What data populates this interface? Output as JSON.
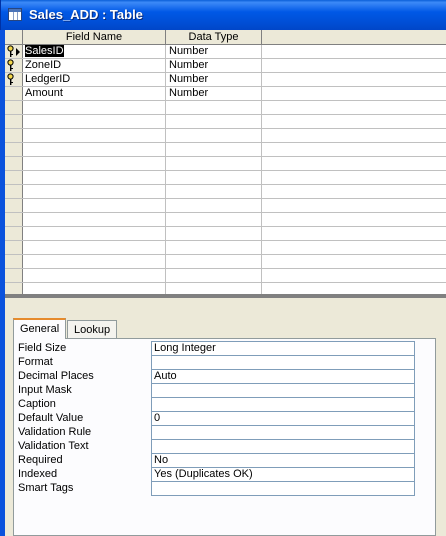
{
  "window": {
    "title": "Sales_ADD : Table"
  },
  "grid": {
    "columns": [
      "Field Name",
      "Data Type"
    ],
    "rows": [
      {
        "name": "SalesID",
        "type": "Number",
        "key": true,
        "current": true
      },
      {
        "name": "ZoneID",
        "type": "Number",
        "key": true,
        "current": false
      },
      {
        "name": "LedgerID",
        "type": "Number",
        "key": true,
        "current": false
      },
      {
        "name": "Amount",
        "type": "Number",
        "key": false,
        "current": false
      }
    ]
  },
  "tabs": {
    "general": "General",
    "lookup": "Lookup"
  },
  "properties": [
    {
      "label": "Field Size",
      "value": "Long Integer"
    },
    {
      "label": "Format",
      "value": ""
    },
    {
      "label": "Decimal Places",
      "value": "Auto"
    },
    {
      "label": "Input Mask",
      "value": ""
    },
    {
      "label": "Caption",
      "value": ""
    },
    {
      "label": "Default Value",
      "value": "0"
    },
    {
      "label": "Validation Rule",
      "value": ""
    },
    {
      "label": "Validation Text",
      "value": ""
    },
    {
      "label": "Required",
      "value": "No"
    },
    {
      "label": "Indexed",
      "value": "Yes (Duplicates OK)"
    },
    {
      "label": "Smart Tags",
      "value": ""
    }
  ],
  "icons": {
    "title": "table-icon",
    "key": "primary-key-icon",
    "current": "current-row-arrow-icon"
  },
  "colors": {
    "titlebar": "#0054e3",
    "chrome": "#ece9d8",
    "tab_accent": "#e68b2c"
  }
}
